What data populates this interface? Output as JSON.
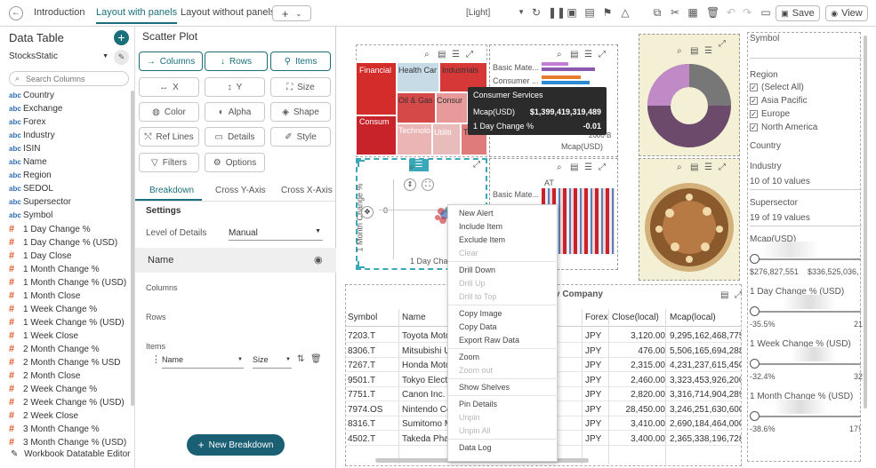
{
  "topbar": {
    "tabs": [
      {
        "label": "Introduction"
      },
      {
        "label": "Layout with panels"
      },
      {
        "label": "Layout without panels"
      }
    ],
    "theme": "[Light]",
    "save_label": "Save",
    "view_label": "View"
  },
  "left": {
    "title": "Data Table",
    "table_name": "StocksStatic",
    "search_placeholder": "Search Columns",
    "fields": [
      {
        "type": "abc",
        "name": "Country"
      },
      {
        "type": "abc",
        "name": "Exchange"
      },
      {
        "type": "abc",
        "name": "Forex"
      },
      {
        "type": "abc",
        "name": "Industry"
      },
      {
        "type": "abc",
        "name": "ISIN"
      },
      {
        "type": "abc",
        "name": "Name"
      },
      {
        "type": "abc",
        "name": "Region"
      },
      {
        "type": "abc",
        "name": "SEDOL"
      },
      {
        "type": "abc",
        "name": "Supersector"
      },
      {
        "type": "abc",
        "name": "Symbol"
      },
      {
        "type": "#",
        "name": "1 Day Change %"
      },
      {
        "type": "#",
        "name": "1 Day Change % (USD)"
      },
      {
        "type": "#",
        "name": "1 Day Close"
      },
      {
        "type": "#",
        "name": "1 Month Change %"
      },
      {
        "type": "#",
        "name": "1 Month Change % (USD)"
      },
      {
        "type": "#",
        "name": "1 Month Close"
      },
      {
        "type": "#",
        "name": "1 Week Change %"
      },
      {
        "type": "#",
        "name": "1 Week Change % (USD)"
      },
      {
        "type": "#",
        "name": "1 Week Close"
      },
      {
        "type": "#",
        "name": "2 Month Change %"
      },
      {
        "type": "#",
        "name": "2 Month Change % USD"
      },
      {
        "type": "#",
        "name": "2 Month Close"
      },
      {
        "type": "#",
        "name": "2 Week Change %"
      },
      {
        "type": "#",
        "name": "2 Week Change % (USD)"
      },
      {
        "type": "#",
        "name": "2 Week Close"
      },
      {
        "type": "#",
        "name": "3 Month Change %"
      },
      {
        "type": "#",
        "name": "3 Month Change % (USD)"
      }
    ],
    "footer": "Workbook Datatable Editor"
  },
  "middle": {
    "title": "Scatter Plot",
    "row1": [
      "Columns",
      "Rows",
      "Items"
    ],
    "row2": [
      "X",
      "Y",
      "Size"
    ],
    "row3": [
      "Color",
      "Alpha",
      "Shape"
    ],
    "row4": [
      "Ref Lines",
      "Details",
      "Style"
    ],
    "row5": [
      "Filters",
      "Options"
    ],
    "subtabs": [
      "Breakdown",
      "Cross Y-Axis",
      "Cross X-Axis"
    ],
    "settings_label": "Settings",
    "lod_label": "Level of Details",
    "lod_value": "Manual",
    "name_label": "Name",
    "columns_label": "Columns",
    "rows_label": "Rows",
    "items_label": "Items",
    "item_name": "Name",
    "item_size": "Size",
    "new_breakdown": "New Breakdown"
  },
  "canvas": {
    "treemap_labels": [
      "Financial",
      "Health Car",
      "Industrials",
      "Oil & Gas",
      "Consur",
      "Consum",
      "Technolo",
      "Utiliti",
      "Te"
    ],
    "bar_labels": [
      "Basic Mate...",
      "Consumer ..."
    ],
    "bar_axis": "2000 B",
    "bar_axis_title": "Mcap(USD)",
    "tooltip": {
      "title": "Consumer Services",
      "rows": [
        {
          "label": "Mcap(USD)",
          "value": "$1,399,419,319,489"
        },
        {
          "label": "1 Day Change %",
          "value": "-0.01"
        }
      ]
    },
    "scatter_ylabel": "1 Month Change %",
    "scatter_xlabel": "1 Day Change",
    "scatter_zero": "0",
    "heatmap_labels": [
      "Basic Mate...",
      "AT"
    ],
    "table_title": "y Company",
    "table_headers": [
      "Symbol",
      "Name",
      "Forex",
      "Close(local)",
      "Mcap(local)"
    ],
    "table_rows": [
      [
        "7203.T",
        "Toyota Moto",
        "JPY",
        "3,120.00",
        "9,295,162,468,775"
      ],
      [
        "8306.T",
        "Mitsubishi U",
        "JPY",
        "476.00",
        "5,506,165,694,288"
      ],
      [
        "7267.T",
        "Honda Moto",
        "JPY",
        "2,315.00",
        "4,231,237,615,450"
      ],
      [
        "9501.T",
        "Tokyo Electri",
        "JPY",
        "2,460.00",
        "3,323,453,926,200"
      ],
      [
        "7751.T",
        "Canon Inc.",
        "JPY",
        "2,820.00",
        "3,316,714,904,289"
      ],
      [
        "7974.OS",
        "Nintendo Co",
        "JPY",
        "28,450.00",
        "3,246,251,630,600"
      ],
      [
        "8316.T",
        "Sumitomo M",
        "JPY",
        "3,410.00",
        "2,690,184,464,000"
      ],
      [
        "4502.T",
        "Takeda Phar",
        "JPY",
        "3,400.00",
        "2,365,338,196,728"
      ]
    ],
    "context_menu": [
      {
        "label": "New Alert",
        "enabled": true
      },
      {
        "label": "Include Item",
        "enabled": true
      },
      {
        "label": "Exclude Item",
        "enabled": true
      },
      {
        "label": "Clear",
        "enabled": false
      },
      {
        "label": "Drill Down",
        "enabled": true
      },
      {
        "label": "Drill Up",
        "enabled": false
      },
      {
        "label": "Drill to Top",
        "enabled": false
      },
      {
        "label": "Copy Image",
        "enabled": true
      },
      {
        "label": "Copy Data",
        "enabled": true
      },
      {
        "label": "Export Raw Data",
        "enabled": true
      },
      {
        "label": "Zoom",
        "enabled": true
      },
      {
        "label": "Zoom out",
        "enabled": false
      },
      {
        "label": "Show Shelves",
        "enabled": true
      },
      {
        "label": "Pin Details",
        "enabled": true
      },
      {
        "label": "Unpin",
        "enabled": false
      },
      {
        "label": "Unpin All",
        "enabled": false
      },
      {
        "label": "Data Log",
        "enabled": true
      }
    ]
  },
  "right": {
    "symbol": "Symbol",
    "region": "Region",
    "region_items": [
      {
        "label": "(Select All)",
        "checked": true
      },
      {
        "label": "Asia Pacific",
        "checked": true
      },
      {
        "label": "Europe",
        "checked": true
      },
      {
        "label": "North America",
        "checked": true
      }
    ],
    "country": "Country",
    "industry": "Industry",
    "industry_value": "10 of 10 values",
    "supersector": "Supersector",
    "supersector_value": "19 of 19 values",
    "mcap": "Mcap(USD)",
    "mcap_min": "$276,827,551",
    "mcap_max": "$336,525,036,",
    "day_change": "1 Day Change % (USD)",
    "day_min": "-35.5%",
    "day_max": "21",
    "week_change": "1 Week Change % (USD)",
    "week_min": "-32.4%",
    "week_max": "32",
    "month_change": "1 Month Change % (USD)",
    "month_min": "-38.6%",
    "month_max": "17!"
  }
}
